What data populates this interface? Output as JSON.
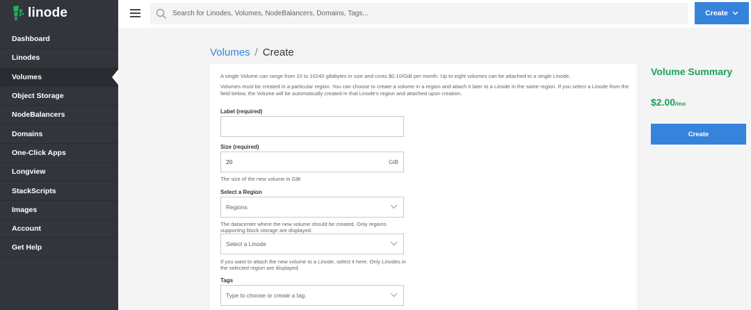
{
  "app": {
    "logo_text": "linode"
  },
  "sidebar": {
    "items": [
      {
        "label": "Dashboard"
      },
      {
        "label": "Linodes"
      },
      {
        "label": "Volumes"
      },
      {
        "label": "Object Storage"
      },
      {
        "label": "NodeBalancers"
      },
      {
        "label": "Domains"
      },
      {
        "label": "One-Click Apps"
      },
      {
        "label": "Longview"
      },
      {
        "label": "StackScripts"
      },
      {
        "label": "Images"
      },
      {
        "label": "Account"
      },
      {
        "label": "Get Help"
      }
    ],
    "active_index": 2
  },
  "topbar": {
    "search_placeholder": "Search for Linodes, Volumes, NodeBalancers, Domains, Tags...",
    "create_label": "Create"
  },
  "breadcrumb": {
    "parent": "Volumes",
    "separator": "/",
    "current": "Create"
  },
  "form": {
    "intro_1": "A single Volume can range from 10 to 10240 gibibytes in size and costs $0.10/GiB per month. Up to eight volumes can be attached to a single Linode.",
    "intro_2": "Volumes must be created in a particular region. You can choose to create a volume in a region and attach it later to a Linode in the same region. If you select a Linode from the field below, the Volume will be automatically created in that Linode's region and attached upon creation.",
    "label_label": "Label (required)",
    "label_value": "",
    "size_label": "Size (required)",
    "size_value": "20",
    "size_unit": "GiB",
    "size_help": "The size of the new volume in GiB",
    "region_label": "Select a Region",
    "region_placeholder": "Regions",
    "region_help": "The datacenter where the new volume should be created. Only regions supporting block storage are displayed.",
    "linode_placeholder": "Select a Linode",
    "linode_help": "If you want to attach the new volume to a Linode, select it here. Only Linodes in the selected region are displayed.",
    "tags_label": "Tags",
    "tags_placeholder": "Type to choose or create a tag."
  },
  "summary": {
    "title": "Volume Summary",
    "price": "$2.00",
    "price_unit": "/mo",
    "create_label": "Create"
  },
  "colors": {
    "accent": "#3683dc",
    "sidebar_bg": "#32363c",
    "summary_green": "#1c9f5a"
  }
}
